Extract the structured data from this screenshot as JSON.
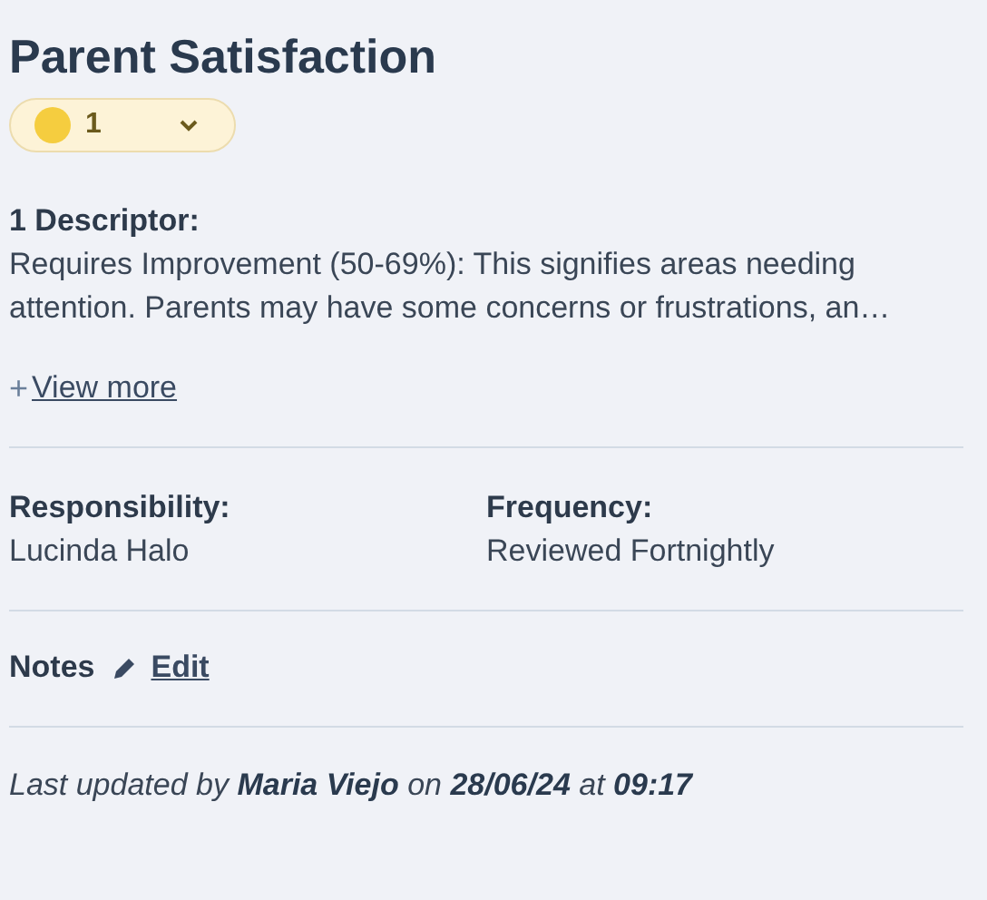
{
  "title": "Parent Satisfaction",
  "rating": {
    "value": "1",
    "color": "#f5cd3f"
  },
  "descriptor": {
    "label": "1 Descriptor:",
    "text": "Requires Improvement (50-69%): This signifies areas needing attention. Parents may have some concerns or frustrations, an…"
  },
  "view_more": {
    "icon": "+",
    "label": "View more"
  },
  "fields": [
    {
      "label": "Responsibility:",
      "value": "Lucinda Halo"
    },
    {
      "label": "Frequency:",
      "value": "Reviewed Fortnightly"
    }
  ],
  "notes": {
    "label": "Notes",
    "edit": "Edit"
  },
  "footer": "Last updated by **Maria Viejo** on **28/06/24** at **09:17**"
}
